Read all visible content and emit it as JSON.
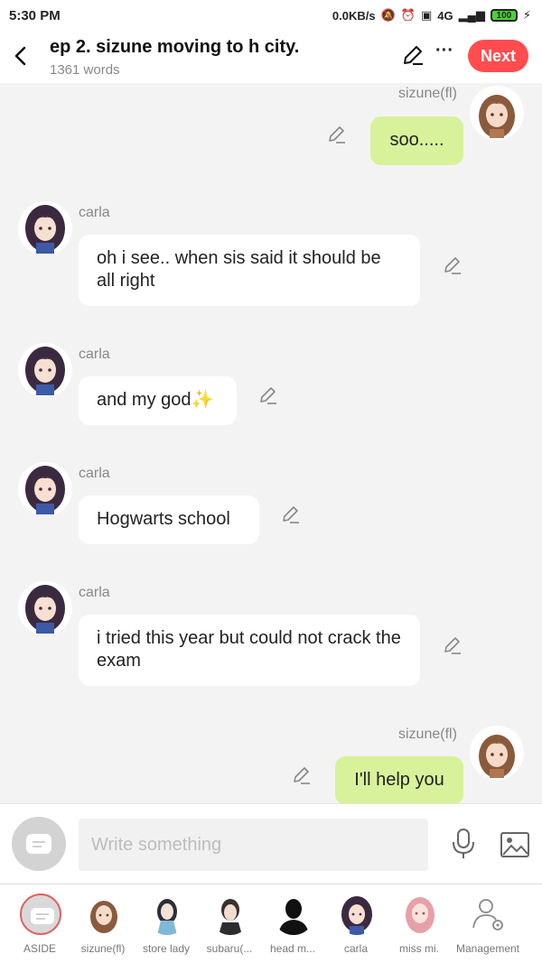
{
  "status_bar": {
    "time": "5:30 PM",
    "net_speed": "0.0KB/s",
    "network": "4G",
    "battery": "100"
  },
  "header": {
    "title": "ep 2. sizune moving to h city.",
    "word_count": "1361 words",
    "next_label": "Next"
  },
  "messages": [
    {
      "side": "right",
      "speaker": "sizune(fl)",
      "text": "soo....."
    },
    {
      "side": "left",
      "speaker": "carla",
      "text": "oh i see.. when sis said it should be all right"
    },
    {
      "side": "left",
      "speaker": "carla",
      "text": "and my god✨"
    },
    {
      "side": "left",
      "speaker": "carla",
      "text": "Hogwarts school"
    },
    {
      "side": "left",
      "speaker": "carla",
      "text": "i tried this year but could not crack the exam"
    },
    {
      "side": "right",
      "speaker": "sizune(fl)",
      "text": "I'll help you"
    }
  ],
  "composer": {
    "placeholder": "Write something"
  },
  "characters": [
    {
      "label": "ASIDE"
    },
    {
      "label": "sizune(fl)"
    },
    {
      "label": "store lady"
    },
    {
      "label": "subaru(..."
    },
    {
      "label": "head m..."
    },
    {
      "label": "carla"
    },
    {
      "label": "miss mi."
    },
    {
      "label": "Management"
    }
  ],
  "colors": {
    "accent": "#ff4d4f",
    "bubble_self": "#d7f29a",
    "bubble_other": "#ffffff",
    "background": "#f3f3f3"
  }
}
